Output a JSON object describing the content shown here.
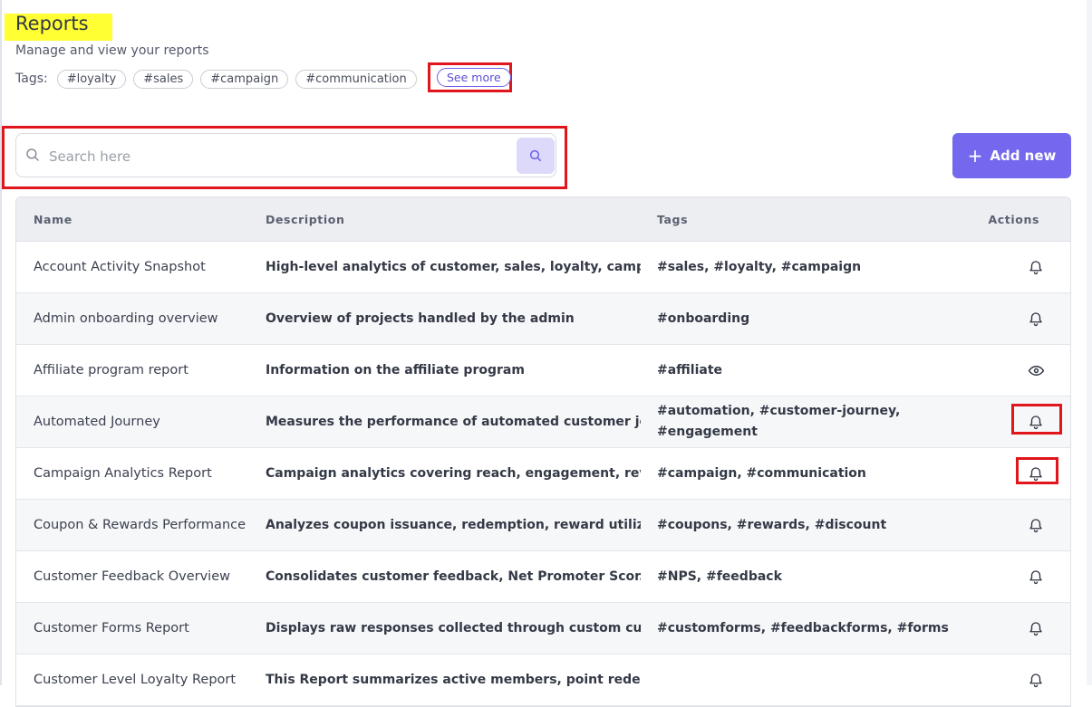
{
  "header": {
    "title": "Reports",
    "subtitle": "Manage and view your reports",
    "tags_label": "Tags:",
    "tags": [
      "#loyalty",
      "#sales",
      "#campaign",
      "#communication"
    ],
    "see_more": "See more"
  },
  "search": {
    "placeholder": "Search here",
    "value": ""
  },
  "add_button": {
    "label": "Add new"
  },
  "table": {
    "columns": [
      "Name",
      "Description",
      "Tags",
      "Actions"
    ],
    "rows": [
      {
        "name": "Account Activity Snapshot",
        "description": "High-level analytics of customer, sales, loyalty, camp...",
        "tags": "#sales, #loyalty, #campaign",
        "action_icon": "bell-icon"
      },
      {
        "name": "Admin onboarding overview",
        "description": "Overview of projects handled by the admin",
        "tags": "#onboarding",
        "action_icon": "bell-icon"
      },
      {
        "name": "Affiliate program report",
        "description": "Information on the affiliate program",
        "tags": "#affiliate",
        "action_icon": "eye-icon"
      },
      {
        "name": "Automated Journey",
        "description": "Measures the performance of automated customer jo...",
        "tags": "#automation, #customer-journey, #engagement",
        "action_icon": "bell-icon"
      },
      {
        "name": "Campaign Analytics Report",
        "description": "Campaign analytics covering reach, engagement, rev...",
        "tags": "#campaign, #communication",
        "action_icon": "bell-icon"
      },
      {
        "name": "Coupon & Rewards Performance",
        "description": "Analyzes coupon issuance, redemption, reward utiliz...",
        "tags": "#coupons, #rewards, #discount",
        "action_icon": "bell-icon"
      },
      {
        "name": "Customer Feedback Overview",
        "description": "Consolidates customer feedback, Net Promoter Scor...",
        "tags": "#NPS, #feedback",
        "action_icon": "bell-icon"
      },
      {
        "name": "Customer Forms Report",
        "description": "Displays raw responses collected through custom cu...",
        "tags": "#customforms, #feedbackforms, #forms",
        "action_icon": "bell-icon"
      },
      {
        "name": "Customer Level Loyalty Report",
        "description": "This Report summarizes active members, point rede...",
        "tags": "",
        "action_icon": "bell-icon"
      }
    ]
  },
  "colors": {
    "accent": "#7468ee",
    "highlight": "#ffff33",
    "annotation": "#e0161c"
  }
}
